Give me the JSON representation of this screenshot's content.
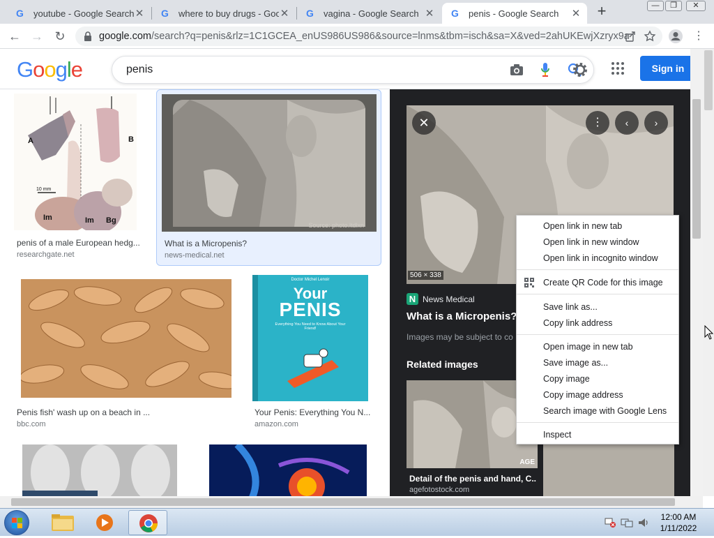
{
  "tabs": [
    {
      "title": "youtube - Google Search",
      "close": "✕"
    },
    {
      "title": "where to buy drugs - Goog",
      "close": "✕"
    },
    {
      "title": "vagina - Google Search",
      "close": "✕"
    },
    {
      "title": "penis - Google Search",
      "close": "✕",
      "active": true
    }
  ],
  "new_tab": "+",
  "window_controls": {
    "minimize": "—",
    "maximize": "❐",
    "close": "✕"
  },
  "address": {
    "host": "google.com",
    "path": "/search?q=penis&rlz=1C1GCEA_enUS986US986&source=lnms&tbm=isch&sa=X&ved=2ahUKEwjXzryx9aj..."
  },
  "google": {
    "logo_letters": [
      "G",
      "o",
      "o",
      "g",
      "l",
      "e"
    ],
    "logo_colors": [
      "#4285f4",
      "#ea4335",
      "#fbbc05",
      "#4285f4",
      "#34a853",
      "#ea4335"
    ],
    "query": "penis",
    "signin": "Sign in"
  },
  "results": [
    {
      "caption": "penis of a male European hedg...",
      "source": "researchgate.net"
    },
    {
      "caption": "What is a Micropenis?",
      "source": "news-medical.net",
      "watermark": "Source: photo.ltdlxn"
    },
    {
      "caption": "Penis fish' wash up on a beach in ...",
      "source": "bbc.com"
    },
    {
      "caption": "Your Penis: Everything You N...",
      "source": "amazon.com"
    }
  ],
  "diagram_labels": {
    "a": "A",
    "b": "B",
    "im": "Im",
    "im2": "Im",
    "bg": "Bg",
    "scale": "10 mm"
  },
  "book": {
    "author": "Doctor Michel Lenoir",
    "title1": "Your",
    "title2": "PENIS",
    "subtitle": "Everything You Need to Know About Your Friend!"
  },
  "panel": {
    "dimensions": "506 × 338",
    "site_icon": "N",
    "site": "News Medical",
    "title": "What is a Micropenis?",
    "copyright": "Images may be subject to co",
    "related_heading": "Related images",
    "related": [
      {
        "caption": "Detail of the penis and hand, C...",
        "source": "agefotostock.com",
        "watermark": "AGE"
      }
    ]
  },
  "context_menu": {
    "groups": [
      [
        "Open link in new tab",
        "Open link in new window",
        "Open link in incognito window"
      ],
      [
        "Create QR Code for this image"
      ],
      [
        "Save link as...",
        "Copy link address"
      ],
      [
        "Open image in new tab",
        "Save image as...",
        "Copy image",
        "Copy image address",
        "Search image with Google Lens"
      ],
      [
        "Inspect"
      ]
    ]
  },
  "taskbar": {
    "time": "12:00 AM",
    "date": "1/11/2022"
  }
}
